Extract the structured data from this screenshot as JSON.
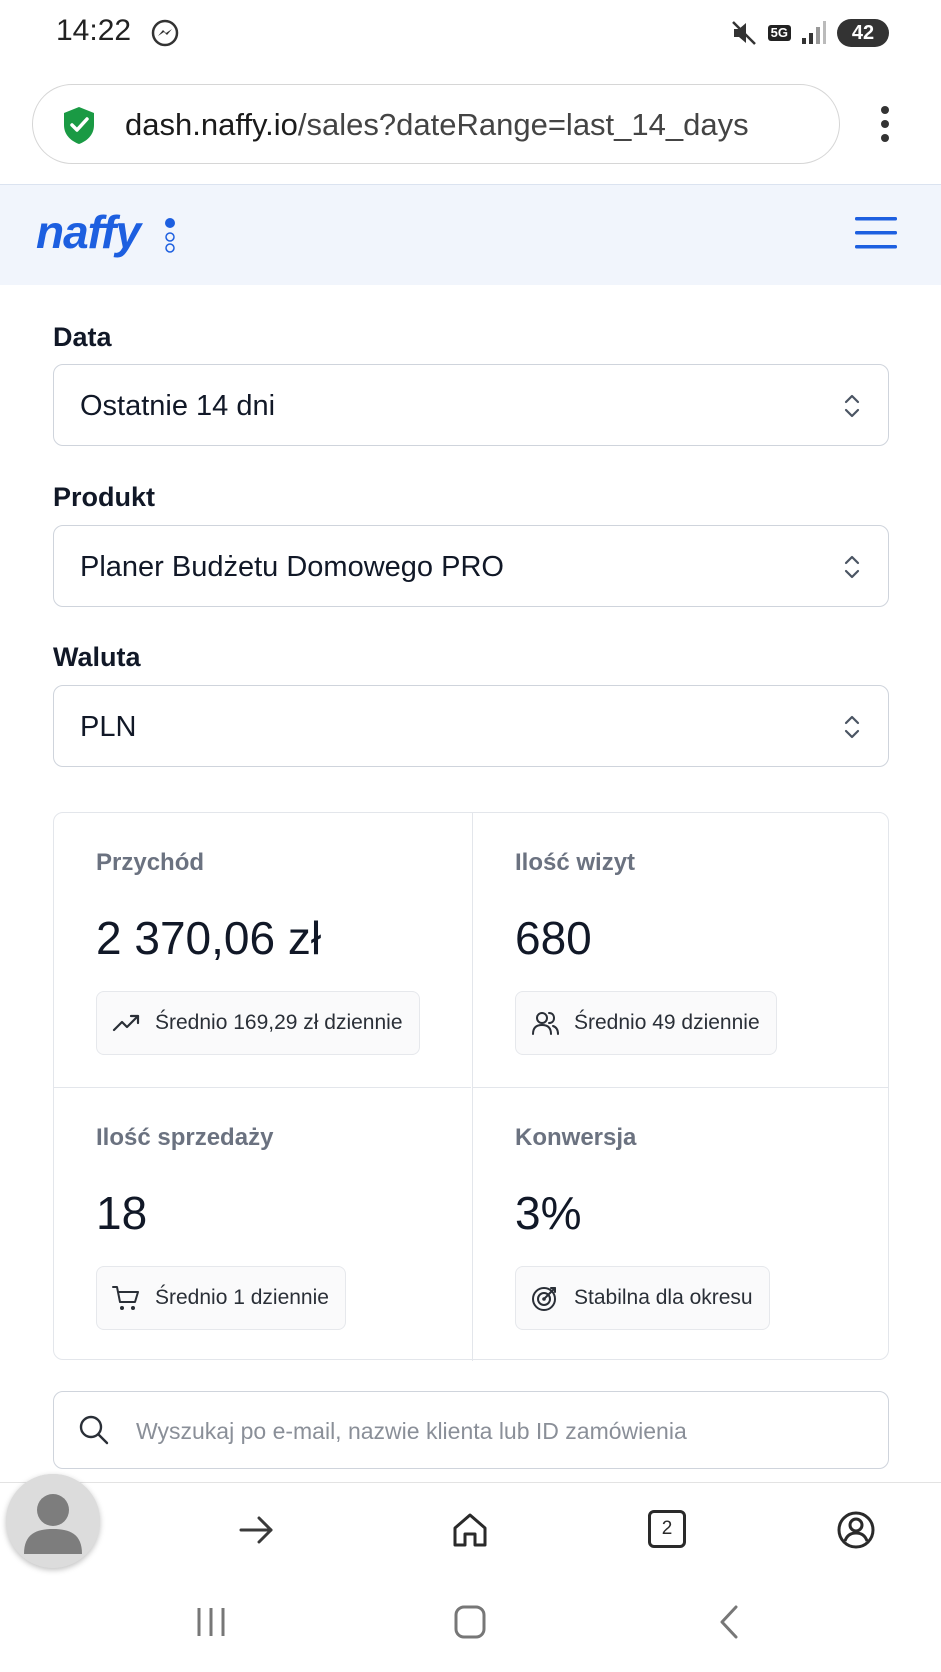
{
  "status_bar": {
    "time": "14:22",
    "network": "5G",
    "battery": "42",
    "icons": [
      "messenger-icon",
      "mute-icon",
      "network-icon",
      "signal-icon",
      "battery-icon"
    ]
  },
  "browser": {
    "url_host": "dash.naffy.io",
    "url_path": "/sales?dateRange=last_14_days",
    "tab_count": "2"
  },
  "app": {
    "logo": "naffy",
    "brand_color": "#1d5fe0"
  },
  "filters": {
    "date": {
      "label": "Data",
      "value": "Ostatnie 14 dni"
    },
    "product": {
      "label": "Produkt",
      "value": "Planer Budżetu Domowego PRO"
    },
    "currency": {
      "label": "Waluta",
      "value": "PLN"
    }
  },
  "stats": [
    {
      "label": "Przychód",
      "value": "2 370,06 zł",
      "note": "Średnio 169,29 zł dziennie",
      "icon": "trending-up-icon"
    },
    {
      "label": "Ilość wizyt",
      "value": "680",
      "note": "Średnio 49 dziennie",
      "icon": "users-icon"
    },
    {
      "label": "Ilość sprzedaży",
      "value": "18",
      "note": "Średnio 1 dziennie",
      "icon": "cart-icon"
    },
    {
      "label": "Konwersja",
      "value": "3%",
      "note": "Stabilna dla okresu",
      "icon": "target-icon"
    }
  ],
  "search": {
    "placeholder": "Wyszukaj po e-mail, nazwie klienta lub ID zamówienia"
  }
}
